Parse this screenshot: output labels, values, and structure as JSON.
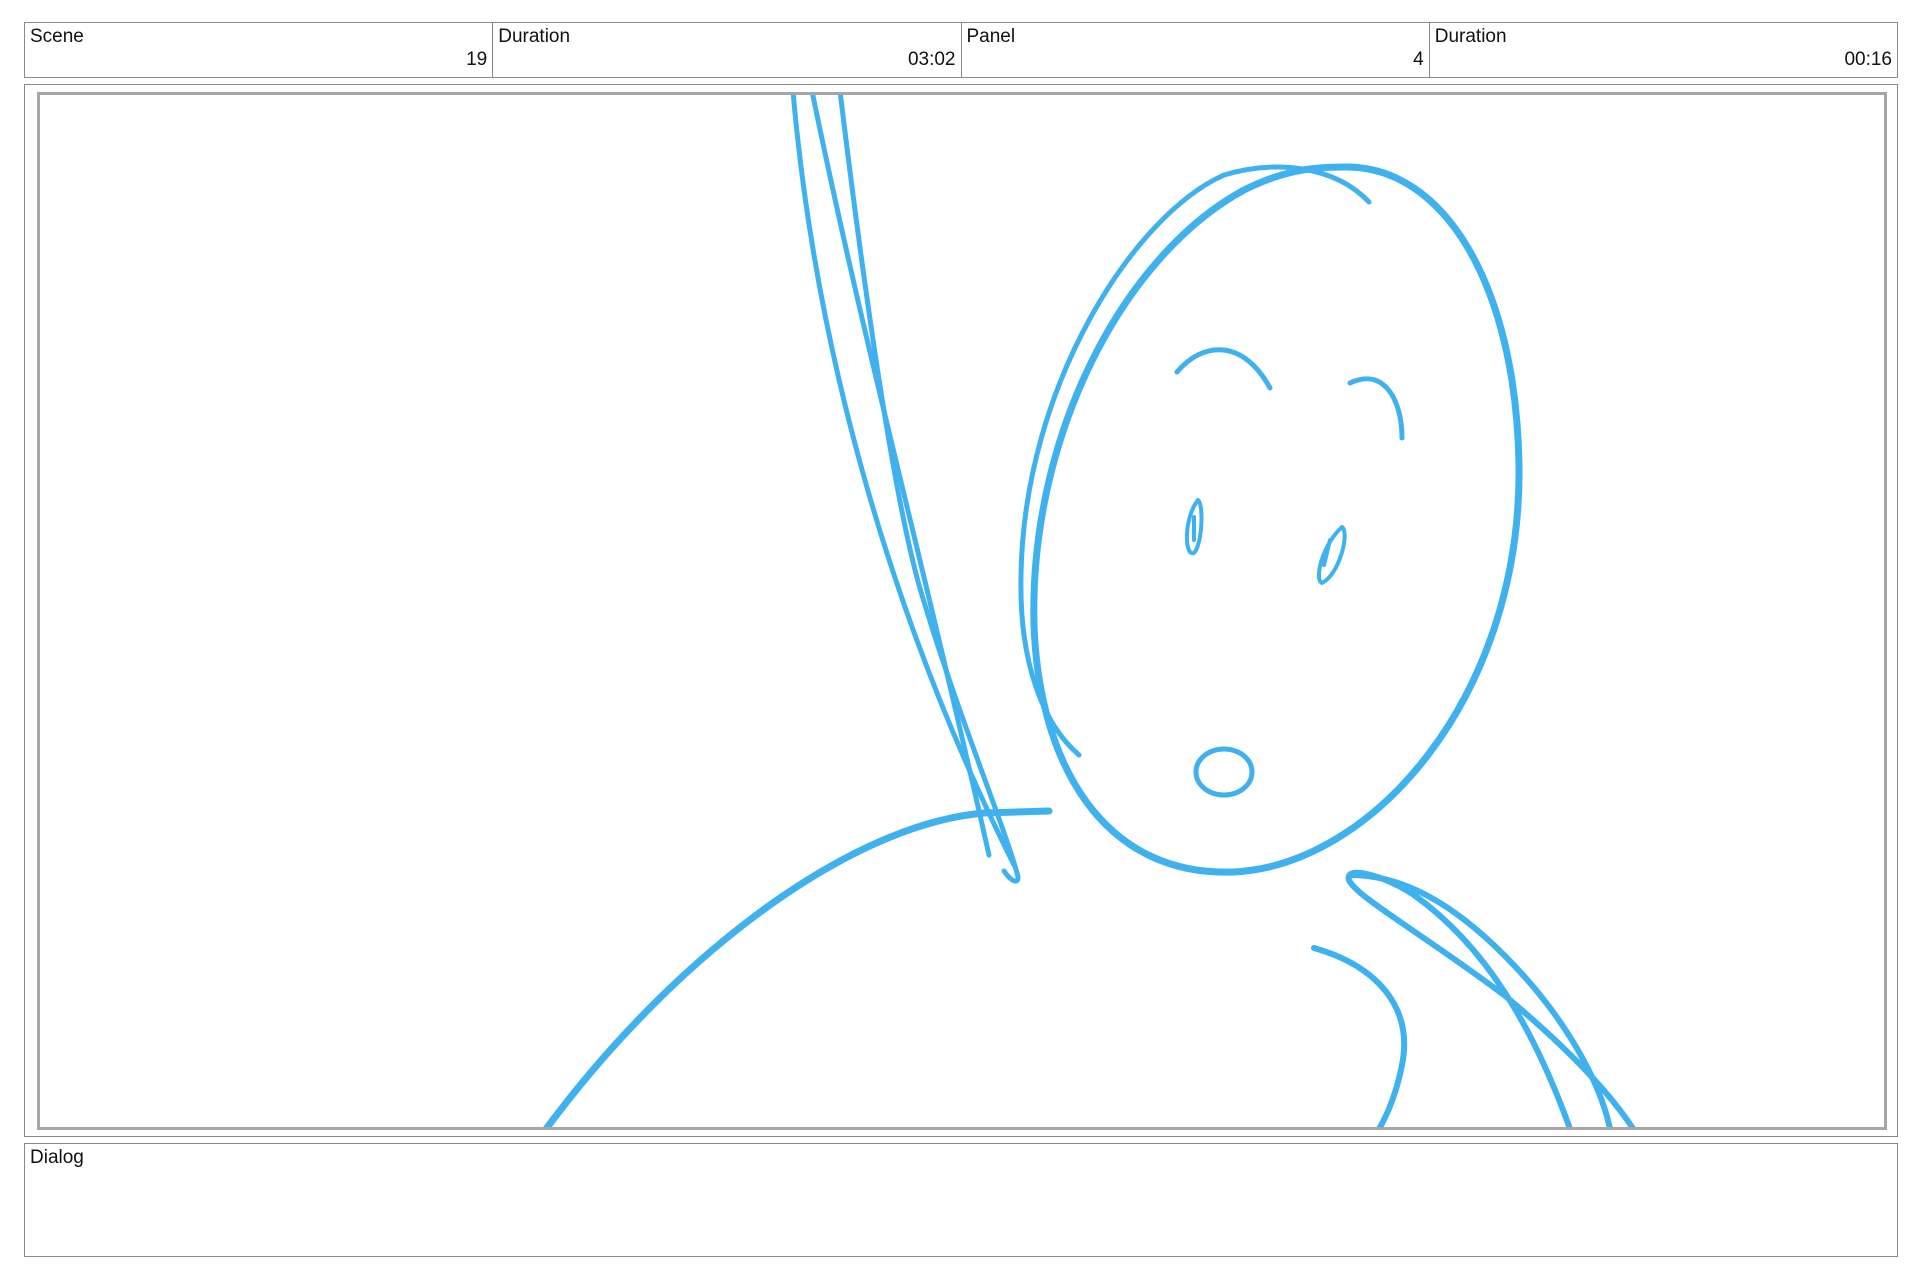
{
  "header": {
    "scene": {
      "label": "Scene",
      "value": "19"
    },
    "scene_duration": {
      "label": "Duration",
      "value": "03:02"
    },
    "panel": {
      "label": "Panel",
      "value": "4"
    },
    "panel_duration": {
      "label": "Duration",
      "value": "00:16"
    }
  },
  "dialog": {
    "label": "Dialog",
    "text": ""
  },
  "colors": {
    "sketch_stroke": "#3fb1ef",
    "border": "#8a8a8a",
    "panel_border": "#a6a6a6"
  }
}
